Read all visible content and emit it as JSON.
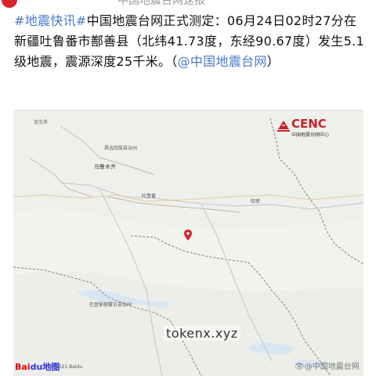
{
  "header": {
    "partial_text": "中国地震台网速报"
  },
  "post": {
    "hashtag": "#地震快讯#",
    "text": "中国地震台网正式测定：06月24日02时27分在新疆吐鲁番市鄯善县（北纬41.73度，东经90.67度）发生5.1级地震，震源深度25千米。（",
    "mention": "@中国地震台网",
    "close": "）"
  },
  "map": {
    "logo_title": "CENC",
    "logo_subtitle": "中国地震台网中心",
    "labels": {
      "top_left": "北屯市",
      "changji": "昌吉回族自治州",
      "urumqi": "乌鲁木齐",
      "turpan": "吐鲁番",
      "hami": "哈密",
      "bayingol": "巴音郭楞蒙古自治州"
    },
    "watermark": "tokenx.xyz",
    "baidu_bai": "Bai",
    "baidu_du": "du地图",
    "copyright": "© 2021 Baidu",
    "weibo_eye": "👁",
    "weibo_handle": "@中国地震台网"
  },
  "colors": {
    "hashtag": "#4a7ac8",
    "pin": "#d8232a",
    "cenc": "#c8222a",
    "border": "#8a6b4e"
  }
}
